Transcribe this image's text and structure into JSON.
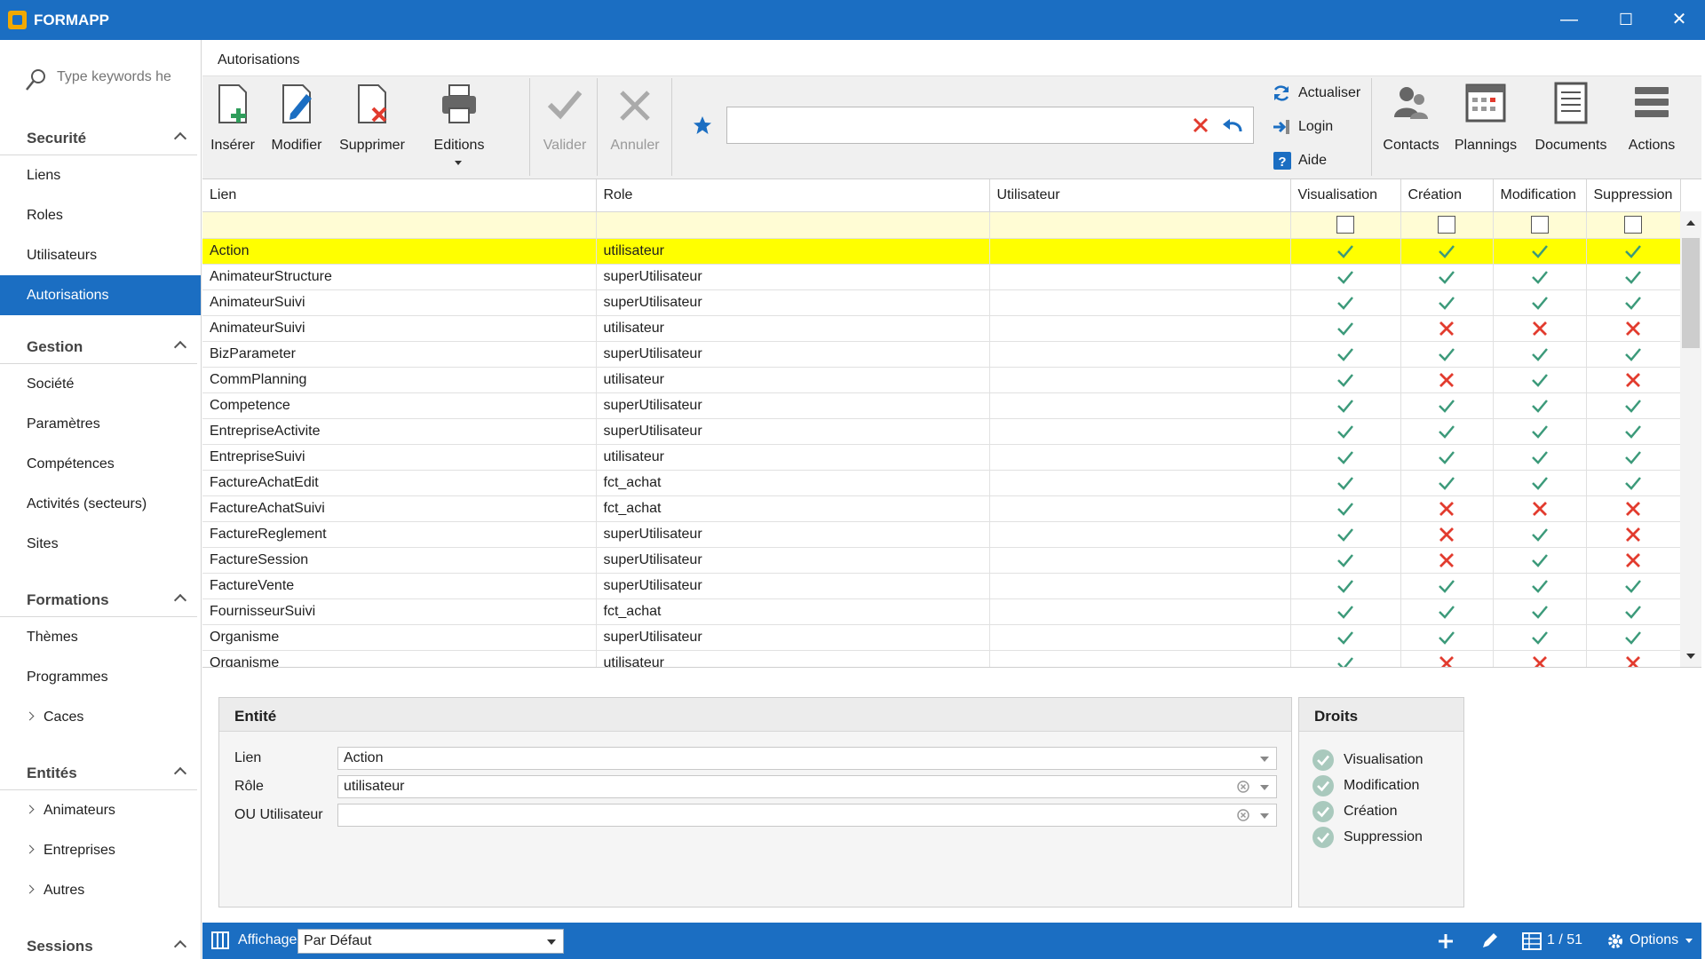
{
  "app": {
    "name": "FORMAPP",
    "minimize": "—",
    "maximize": "☐",
    "close": "✕"
  },
  "sidebar": {
    "search_placeholder": "Type keywords here",
    "sections": [
      {
        "title": "Securité",
        "items": [
          "Liens",
          "Roles",
          "Utilisateurs",
          "Autorisations"
        ]
      },
      {
        "title": "Gestion",
        "items": [
          "Société",
          "Paramètres",
          "Compétences",
          "Activités (secteurs)",
          "Sites"
        ]
      },
      {
        "title": "Formations",
        "items": [
          "Thèmes",
          "Programmes",
          "Caces"
        ]
      },
      {
        "title": "Entités",
        "items": [
          "Animateurs",
          "Entreprises",
          "Autres"
        ]
      },
      {
        "title": "Sessions"
      }
    ],
    "active_item": "Autorisations"
  },
  "tab": {
    "title": "Autorisations"
  },
  "toolbar": {
    "insert": "Insérer",
    "edit": "Modifier",
    "delete": "Supprimer",
    "print": "Editions",
    "validate": "Valider",
    "cancel": "Annuler",
    "filter_value": "",
    "refresh": "Actualiser",
    "login": "Login",
    "help": "Aide",
    "contacts": "Contacts",
    "plannings": "Plannings",
    "documents": "Documents",
    "actions": "Actions"
  },
  "grid": {
    "columns": [
      "Lien",
      "Role",
      "Utilisateur",
      "Visualisation",
      "Création",
      "Modification",
      "Suppression"
    ],
    "rows": [
      {
        "lien": "Action",
        "role": "utilisateur",
        "user": "",
        "v": true,
        "c": true,
        "m": true,
        "s": true,
        "selected": true
      },
      {
        "lien": "AnimateurStructure",
        "role": "superUtilisateur",
        "user": "",
        "v": true,
        "c": true,
        "m": true,
        "s": true
      },
      {
        "lien": "AnimateurSuivi",
        "role": "superUtilisateur",
        "user": "",
        "v": true,
        "c": true,
        "m": true,
        "s": true
      },
      {
        "lien": "AnimateurSuivi",
        "role": "utilisateur",
        "user": "",
        "v": true,
        "c": false,
        "m": false,
        "s": false
      },
      {
        "lien": "BizParameter",
        "role": "superUtilisateur",
        "user": "",
        "v": true,
        "c": true,
        "m": true,
        "s": true
      },
      {
        "lien": "CommPlanning",
        "role": "utilisateur",
        "user": "",
        "v": true,
        "c": false,
        "m": true,
        "s": false
      },
      {
        "lien": "Competence",
        "role": "superUtilisateur",
        "user": "",
        "v": true,
        "c": true,
        "m": true,
        "s": true
      },
      {
        "lien": "EntrepriseActivite",
        "role": "superUtilisateur",
        "user": "",
        "v": true,
        "c": true,
        "m": true,
        "s": true
      },
      {
        "lien": "EntrepriseSuivi",
        "role": "utilisateur",
        "user": "",
        "v": true,
        "c": true,
        "m": true,
        "s": true
      },
      {
        "lien": "FactureAchatEdit",
        "role": "fct_achat",
        "user": "",
        "v": true,
        "c": true,
        "m": true,
        "s": true
      },
      {
        "lien": "FactureAchatSuivi",
        "role": "fct_achat",
        "user": "",
        "v": true,
        "c": false,
        "m": false,
        "s": false
      },
      {
        "lien": "FactureReglement",
        "role": "superUtilisateur",
        "user": "",
        "v": true,
        "c": false,
        "m": true,
        "s": false
      },
      {
        "lien": "FactureSession",
        "role": "superUtilisateur",
        "user": "",
        "v": true,
        "c": false,
        "m": true,
        "s": false
      },
      {
        "lien": "FactureVente",
        "role": "superUtilisateur",
        "user": "",
        "v": true,
        "c": true,
        "m": true,
        "s": true
      },
      {
        "lien": "FournisseurSuivi",
        "role": "fct_achat",
        "user": "",
        "v": true,
        "c": true,
        "m": true,
        "s": true
      },
      {
        "lien": "Organisme",
        "role": "superUtilisateur",
        "user": "",
        "v": true,
        "c": true,
        "m": true,
        "s": true
      },
      {
        "lien": "Organisme",
        "role": "utilisateur",
        "user": "",
        "v": true,
        "c": false,
        "m": false,
        "s": false
      }
    ]
  },
  "entity_panel": {
    "title": "Entité",
    "fields": [
      {
        "label": "Lien",
        "value": "Action"
      },
      {
        "label": "Rôle",
        "value": "utilisateur"
      },
      {
        "label": "OU Utilisateur",
        "value": ""
      }
    ]
  },
  "rights_panel": {
    "title": "Droits",
    "items": [
      "Visualisation",
      "Modification",
      "Création",
      "Suppression"
    ]
  },
  "statusbar": {
    "display_label": "Affichage",
    "display_value": "Par Défaut",
    "page": "1 / 51",
    "options": "Options"
  },
  "colors": {
    "accent": "#1b6ec2",
    "ok": "#3c9a7a",
    "ko": "#e23b2e",
    "selected_row": "#ffff00",
    "filter_row": "#fffcd4"
  }
}
